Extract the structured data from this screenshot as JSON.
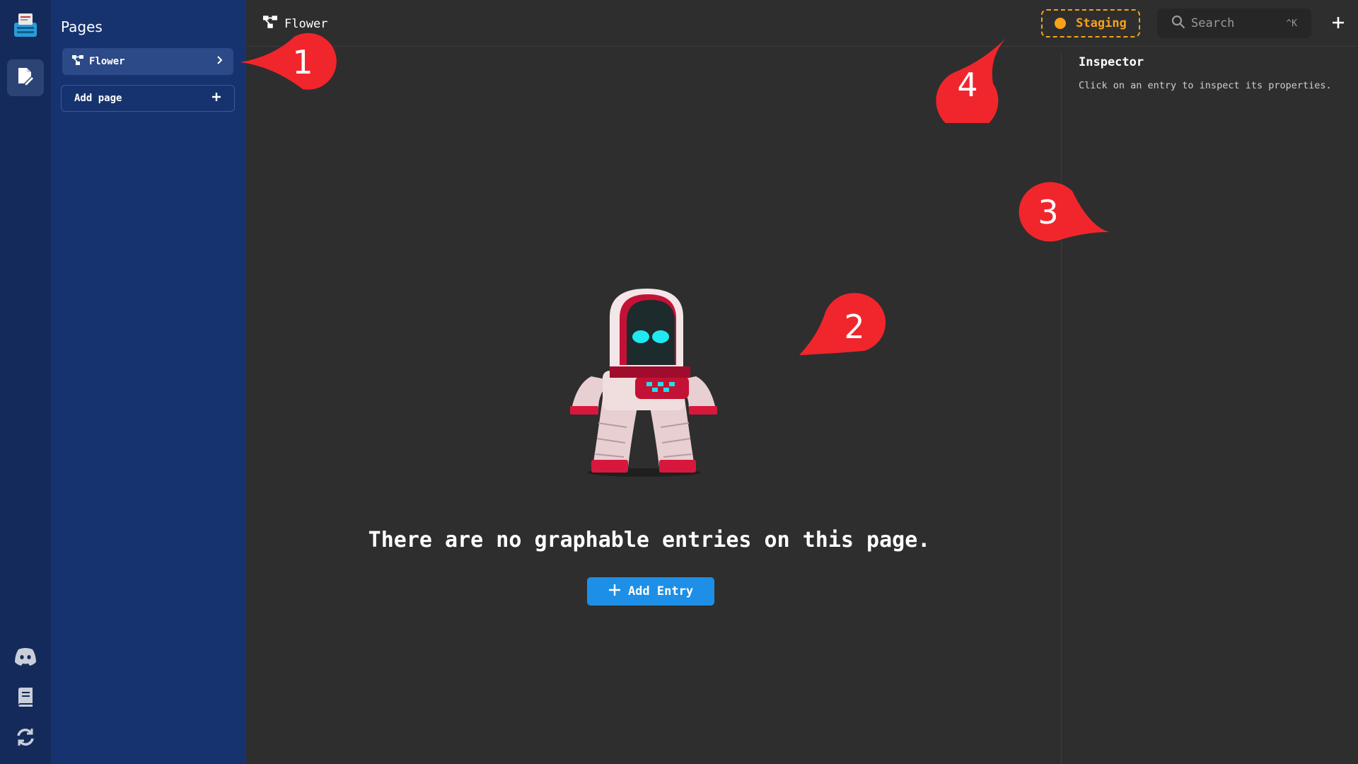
{
  "sidebar": {
    "title": "Pages",
    "pages": [
      {
        "label": "Flower"
      }
    ],
    "add_page_label": "Add page"
  },
  "header": {
    "breadcrumb": "Flower",
    "environment": "Staging",
    "search_placeholder": "Search",
    "search_shortcut": "^K"
  },
  "inspector": {
    "title": "Inspector",
    "hint": "Click on an entry to inspect its properties."
  },
  "main": {
    "empty_message": "There are no graphable entries on this page.",
    "add_entry_label": "Add Entry"
  },
  "callouts": [
    "1",
    "2",
    "3",
    "4"
  ],
  "colors": {
    "rail": "#142a5a",
    "sidebar": "#17336f",
    "canvas": "#2e2e2e",
    "accent": "#1e8fe6",
    "staging": "#f6a21a",
    "callout": "#f0262c"
  },
  "icons": {
    "rail": [
      "app-logo-icon",
      "page-edit-icon",
      "discord-icon",
      "book-icon",
      "refresh-icon"
    ],
    "page": "graph-nodes-icon"
  }
}
